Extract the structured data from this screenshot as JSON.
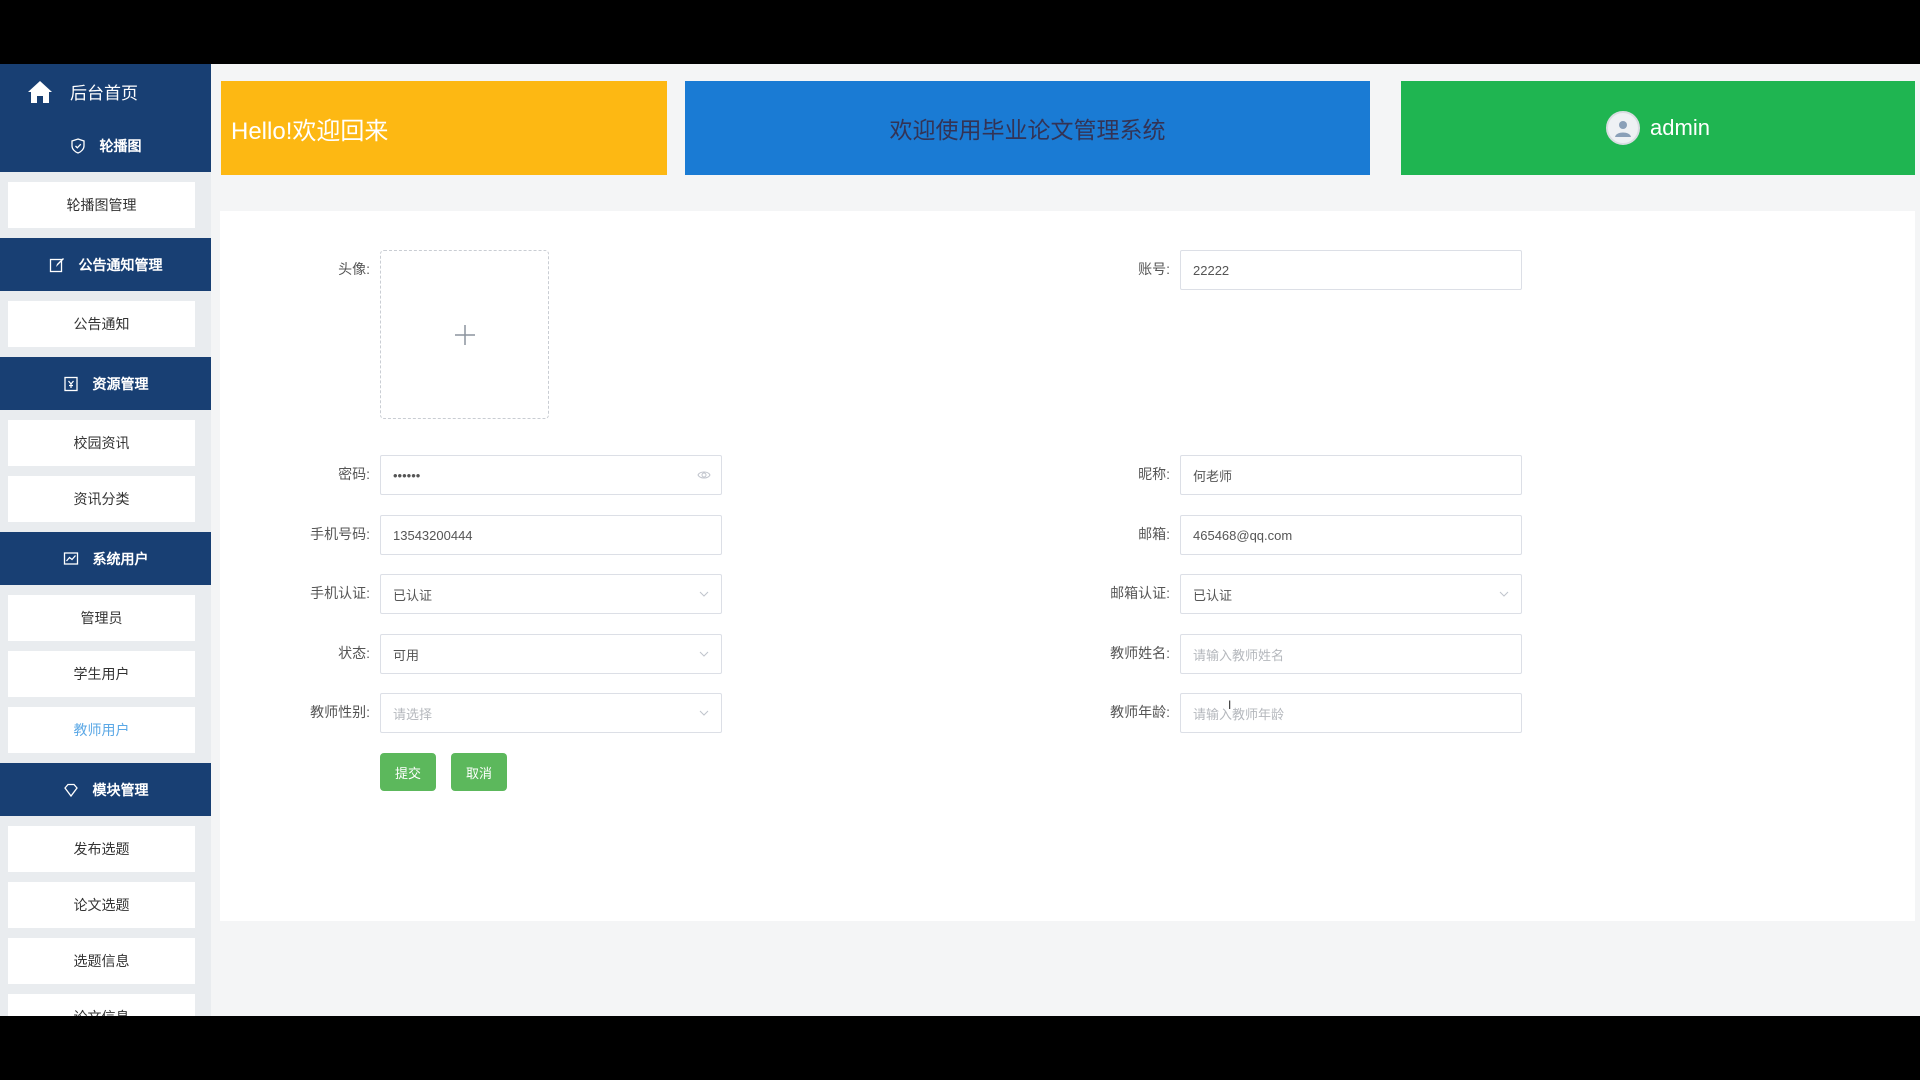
{
  "sidebar": {
    "home": "后台首页",
    "sections": [
      {
        "title": "轮播图",
        "icon": "shield-icon",
        "items": [
          "轮播图管理"
        ]
      },
      {
        "title": "公告通知管理",
        "icon": "edit-icon",
        "items": [
          "公告通知"
        ]
      },
      {
        "title": "资源管理",
        "icon": "resource-icon",
        "items": [
          "校园资讯",
          "资讯分类"
        ]
      },
      {
        "title": "系统用户",
        "icon": "chart-icon",
        "items": [
          "管理员",
          "学生用户",
          "教师用户"
        ]
      },
      {
        "title": "模块管理",
        "icon": "diamond-icon",
        "items": [
          "发布选题",
          "论文选题",
          "选题信息",
          "论文信息"
        ]
      }
    ],
    "active_item": "教师用户"
  },
  "header": {
    "hello": "Hello!欢迎回来",
    "welcome": "欢迎使用毕业论文管理系统",
    "username": "admin"
  },
  "form": {
    "avatar_label": "头像:",
    "account_label": "账号:",
    "account_value": "22222",
    "password_label": "密码:",
    "password_value": "••••••",
    "nickname_label": "昵称:",
    "nickname_value": "何老师",
    "phone_label": "手机号码:",
    "phone_value": "13543200444",
    "email_label": "邮箱:",
    "email_value": "465468@qq.com",
    "phone_verify_label": "手机认证:",
    "phone_verify_value": "已认证",
    "email_verify_label": "邮箱认证:",
    "email_verify_value": "已认证",
    "status_label": "状态:",
    "status_value": "可用",
    "teacher_name_label": "教师姓名:",
    "teacher_name_placeholder": "请输入教师姓名",
    "teacher_gender_label": "教师性别:",
    "teacher_gender_placeholder": "请选择",
    "teacher_age_label": "教师年龄:",
    "teacher_age_placeholder": "请输入教师年龄",
    "submit": "提交",
    "cancel": "取消"
  },
  "colors": {
    "sidebar_header": "#183f73",
    "hello_card": "#fdb813",
    "welcome_card": "#1a7bd4",
    "user_card": "#1fb551",
    "button": "#5cb85c",
    "active_link": "#5ba8e6"
  }
}
